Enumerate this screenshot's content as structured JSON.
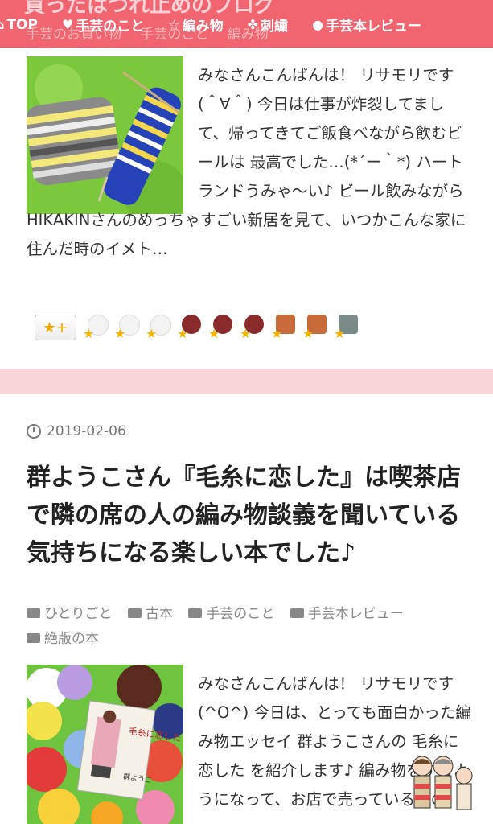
{
  "header": {
    "blog_title": "買ったはつれ止めのブログ",
    "nav": [
      {
        "icon": "home-icon",
        "glyph": "⌂",
        "label": "TOP"
      },
      {
        "icon": "heart-icon",
        "glyph": "♥",
        "label": "手芸のこと"
      },
      {
        "icon": "star-icon",
        "glyph": "☆",
        "label": "編み物"
      },
      {
        "icon": "flower-icon",
        "glyph": "✤",
        "label": "刺繍"
      },
      {
        "icon": "github-icon",
        "glyph": "●",
        "label": "手芸本レビュー"
      }
    ],
    "cats_behind": [
      "手芸のお買い物",
      "手芸のこと",
      "編み物"
    ]
  },
  "post1": {
    "excerpt_side": "みなさんこんばんは！ リサモリです(＾∀＾) 今日は仕事が炸裂してまして、帰ってきてご飯食べながら飲むビールは 最高でした…(*´ー｀*) ハートランドうみゃ〜い♪ ビール飲みながら",
    "excerpt_full": "HIKAKINさんのめっちゃすごい新居を見て、いつかこんな家に住んだ時のイメト…",
    "star_add_label": "★+",
    "stars_count": 9
  },
  "post2": {
    "date": "2019-02-06",
    "title": "群ようこさん『毛糸に恋した』は喫茶店で隣の席の人の編み物談義を聞いている気持ちになる楽しい本でした♪",
    "categories": [
      "ひとりごと",
      "古本",
      "手芸のこと",
      "手芸本レビュー",
      "絶版の本"
    ],
    "excerpt_side": "みなさんこんばんは！ リサモリです(^O^) 今日は、とっても面白かった編み物エッセイ 群ようこさんの 毛糸に恋した を紹介します♪ 編み物をするようになって、お店で売っているもの",
    "book": {
      "title": "毛糸に恋した",
      "author": "群ようこ"
    }
  },
  "colors": {
    "accent": "#f0656f",
    "separator": "#f9d5d9",
    "star": "#f5b400"
  }
}
